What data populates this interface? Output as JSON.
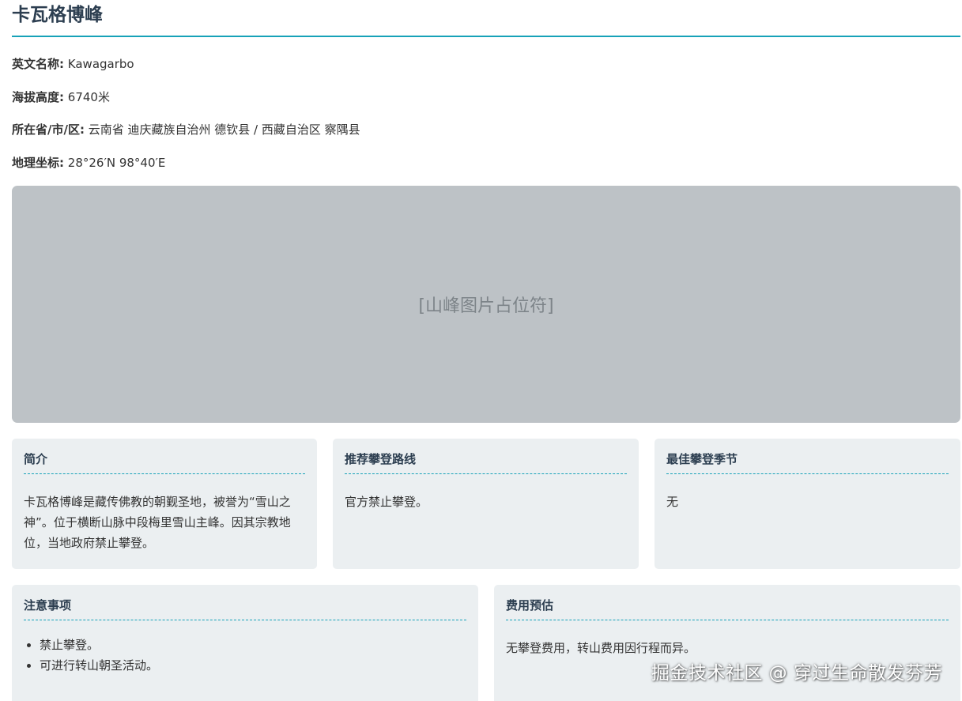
{
  "mountain": {
    "title": "卡瓦格博峰"
  },
  "meta": [
    {
      "label": "英文名称:",
      "value": "Kawagarbo"
    },
    {
      "label": "海拔高度:",
      "value": "6740米"
    },
    {
      "label": "所在省/市/区:",
      "value": "云南省 迪庆藏族自治州 德钦县 / 西藏自治区 察隅县"
    },
    {
      "label": "地理坐标:",
      "value": "28°26′N 98°40′E"
    }
  ],
  "image_placeholder": "[山峰图片占位符]",
  "cards": {
    "intro": {
      "heading": "简介",
      "text": "卡瓦格博峰是藏传佛教的朝觐圣地，被誉为“雪山之神”。位于横断山脉中段梅里雪山主峰。因其宗教地位，当地政府禁止攀登。"
    },
    "route": {
      "heading": "推荐攀登路线",
      "text": "官方禁止攀登。"
    },
    "season": {
      "heading": "最佳攀登季节",
      "text": "无"
    },
    "notes": {
      "heading": "注意事项",
      "items": [
        "禁止攀登。",
        "可进行转山朝圣活动。"
      ]
    },
    "cost": {
      "heading": "费用预估",
      "text": "无攀登费用，转山费用因行程而异。"
    }
  },
  "watermark": "掘金技术社区 @ 穿过生命散发芬芳",
  "colors": {
    "accent": "#17a2b8",
    "heading": "#2c3e50",
    "card_bg": "#ebeff1",
    "placeholder_bg": "#bdc2c6"
  }
}
